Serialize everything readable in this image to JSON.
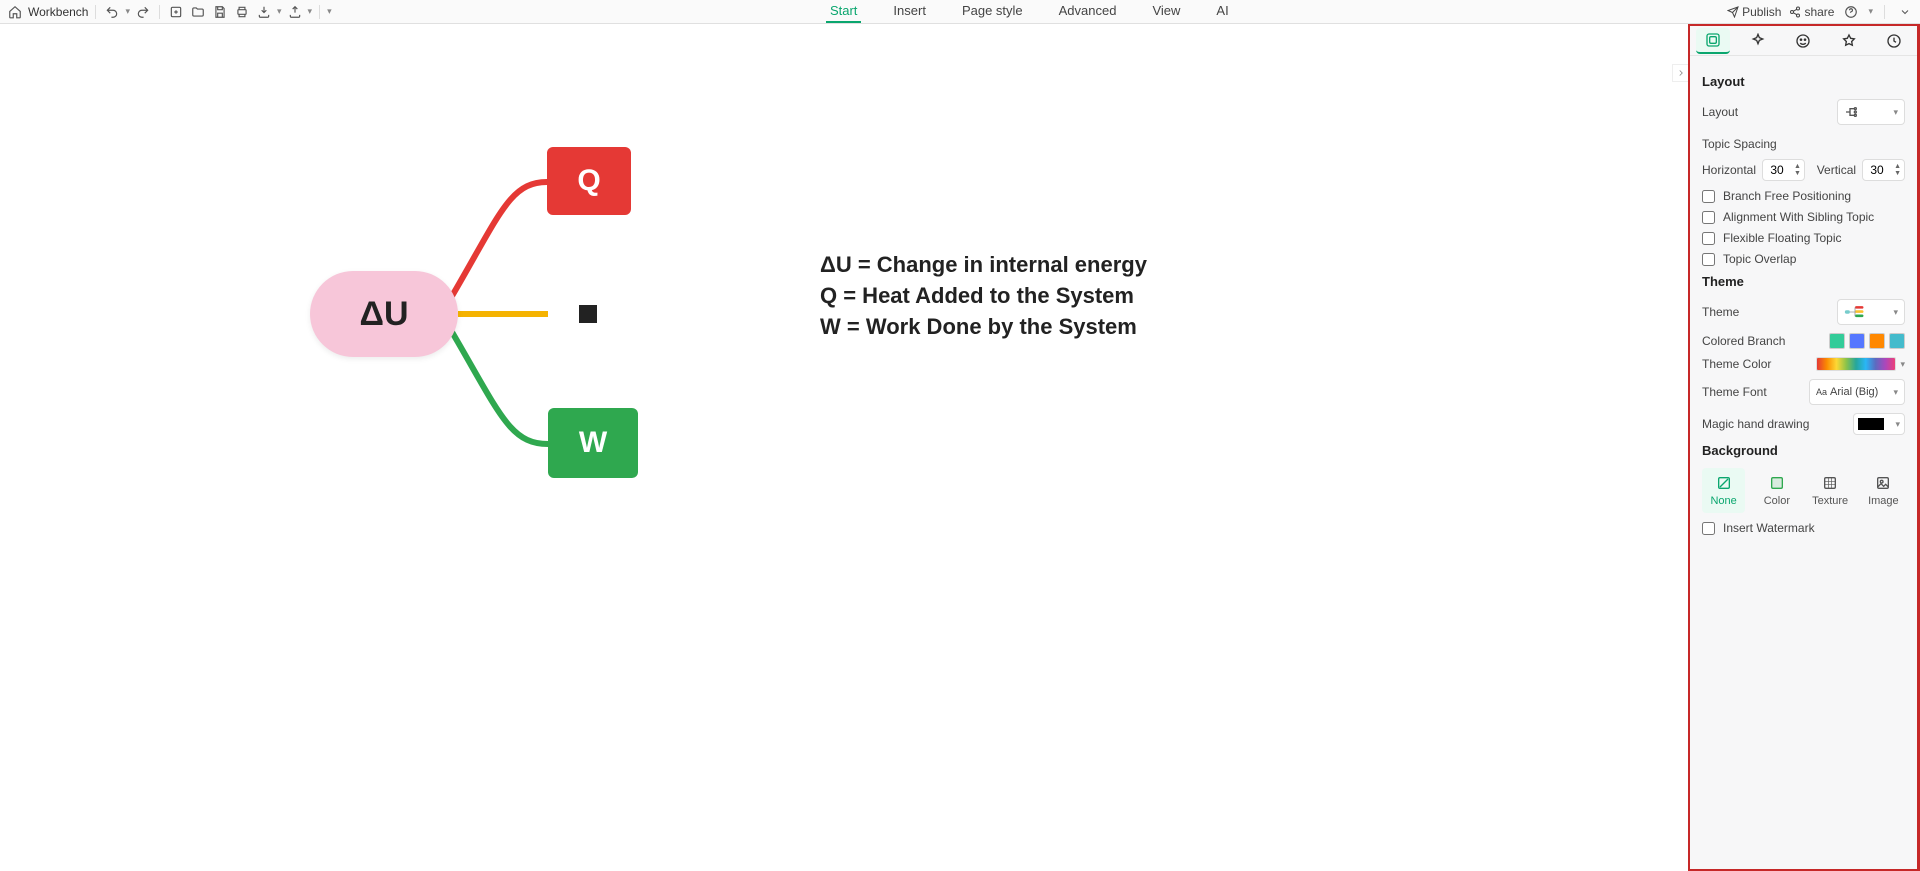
{
  "toolbar": {
    "workbench": "Workbench",
    "publish": "Publish",
    "share": "share"
  },
  "menu": {
    "start": "Start",
    "insert": "Insert",
    "page_style": "Page style",
    "advanced": "Advanced",
    "view": "View",
    "ai": "AI"
  },
  "mindmap": {
    "root": "ΔU",
    "q": "Q",
    "minus": "−",
    "w": "W",
    "legend_1": "ΔU = Change in internal energy",
    "legend_2": "Q = Heat Added to the System",
    "legend_3": "W = Work Done by the System"
  },
  "panel": {
    "layout": {
      "title": "Layout",
      "label_layout": "Layout",
      "topic_spacing": "Topic Spacing",
      "horizontal": "Horizontal",
      "vertical": "Vertical",
      "h_value": "30",
      "v_value": "30",
      "branch_free": "Branch Free Positioning",
      "align_sibling": "Alignment With Sibling Topic",
      "flex_floating": "Flexible Floating Topic",
      "topic_overlap": "Topic Overlap"
    },
    "theme": {
      "title": "Theme",
      "label_theme": "Theme",
      "colored_branch": "Colored Branch",
      "theme_color": "Theme Color",
      "theme_font": "Theme Font",
      "font_value": "Arial (Big)",
      "magic_hand": "Magic hand drawing"
    },
    "background": {
      "title": "Background",
      "none": "None",
      "color": "Color",
      "texture": "Texture",
      "image": "Image",
      "insert_watermark": "Insert Watermark"
    }
  }
}
